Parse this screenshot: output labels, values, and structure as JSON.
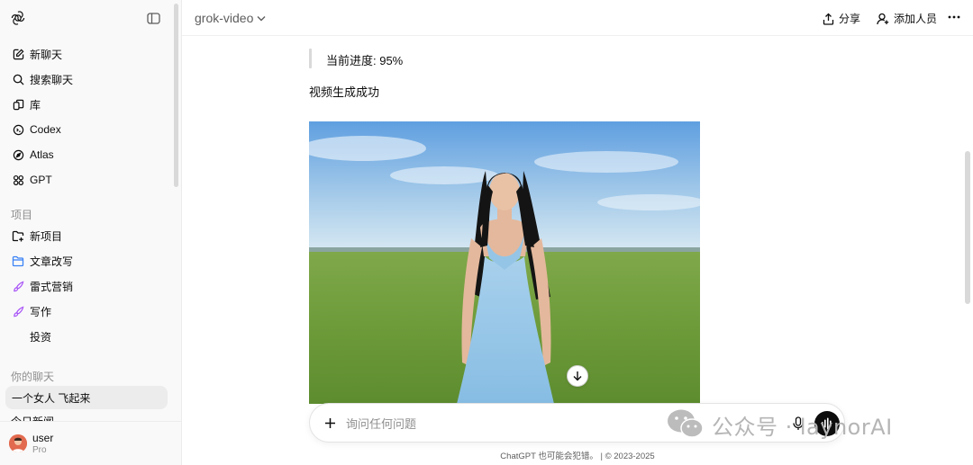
{
  "header": {
    "model": "grok-video",
    "share_label": "分享",
    "add_people_label": "添加人员"
  },
  "sidebar": {
    "nav": [
      {
        "label": "新聊天",
        "icon": "edit-icon"
      },
      {
        "label": "搜索聊天",
        "icon": "search-icon"
      },
      {
        "label": "库",
        "icon": "library-icon"
      },
      {
        "label": "Codex",
        "icon": "codex-icon"
      },
      {
        "label": "Atlas",
        "icon": "compass-icon"
      },
      {
        "label": "GPT",
        "icon": "grid-icon"
      }
    ],
    "projects_label": "项目",
    "projects": [
      {
        "label": "新项目",
        "icon": "folder-plus-icon"
      },
      {
        "label": "文章改写",
        "icon": "folder-icon"
      },
      {
        "label": "雷式营销",
        "icon": "brush-icon"
      },
      {
        "label": "写作",
        "icon": "brush-icon"
      },
      {
        "label": "投资",
        "icon": ""
      }
    ],
    "chats_label": "你的聊天",
    "chats": [
      {
        "label": "一个女人 飞起来",
        "active": true
      },
      {
        "label": "今日新闻",
        "active": false
      }
    ],
    "user": {
      "name": "user",
      "plan": "Pro"
    }
  },
  "main": {
    "progress_text": "当前进度: 95%",
    "progress_value": 95,
    "status_text": "视频生成成功"
  },
  "composer": {
    "placeholder": "询问任何问题"
  },
  "watermark": {
    "text": "公众号 · laynorAI"
  },
  "footer": {
    "disclaimer": "ChatGPT 也可能会犯错。 | © 2023-2025"
  },
  "colors": {
    "sidebar_bg": "#f9f9f9",
    "text": "#0d0d0d",
    "muted": "#8f8f8f",
    "project_blue": "#3b82f6",
    "project_purple": "#a855f7"
  }
}
